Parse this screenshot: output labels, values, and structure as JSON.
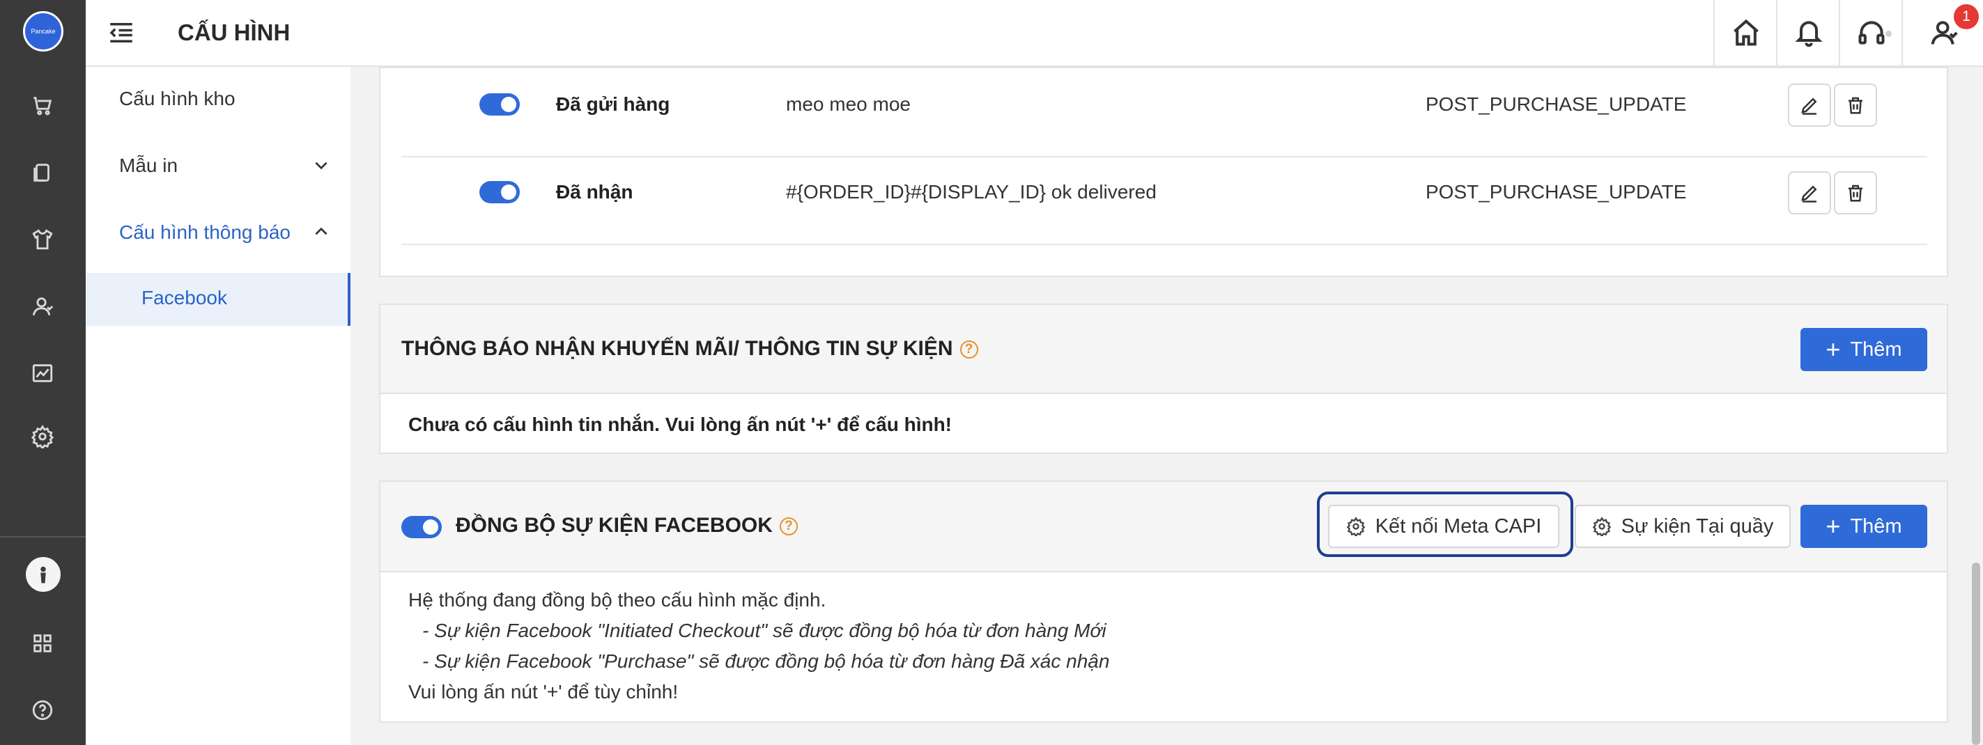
{
  "header": {
    "title": "CẤU HÌNH",
    "notification_badge": "1",
    "icons": [
      "home-icon",
      "bell-icon",
      "headset-icon",
      "user-icon"
    ]
  },
  "rail": {
    "logo_text": "Pancake",
    "icons": [
      "cart-icon",
      "orders-icon",
      "shirt-icon",
      "customers-icon",
      "chart-icon",
      "settings-icon",
      "apps-icon",
      "help-icon"
    ]
  },
  "sidebar": {
    "items": [
      {
        "label": "Cấu hình kho"
      },
      {
        "label": "Mẫu in"
      },
      {
        "label": "Cấu hình thông báo"
      }
    ],
    "sub_item": "Facebook"
  },
  "message_table": {
    "rows": [
      {
        "status": "Đã gửi hàng",
        "message": "meo meo moe",
        "tag": "POST_PURCHASE_UPDATE"
      },
      {
        "status": "Đã nhận",
        "message": "#{ORDER_ID}#{DISPLAY_ID} ok delivered",
        "tag": "POST_PURCHASE_UPDATE"
      }
    ]
  },
  "promo_panel": {
    "title": "THÔNG BÁO NHẬN KHUYẾN MÃI/ THÔNG TIN SỰ KIỆN",
    "add_label": "Thêm",
    "empty_text": "Chưa có cấu hình tin nhắn. Vui lòng ấn nút '+' để cấu hình!"
  },
  "sync_panel": {
    "title": "ĐỒNG BỘ SỰ KIỆN FACEBOOK",
    "connect_label": "Kết nối Meta CAPI",
    "pos_event_label": "Sự kiện Tại quầy",
    "add_label": "Thêm",
    "line1": "Hệ thống đang đồng bộ theo cấu hình mặc định.",
    "line2": "- Sự kiện Facebook \"Initiated Checkout\" sẽ được đồng bộ hóa từ đơn hàng Mới",
    "line3": "- Sự kiện Facebook \"Purchase\" sẽ được đồng bộ hóa từ đơn hàng Đã xác nhận",
    "line4": "Vui lòng ấn nút '+' để tùy chỉnh!"
  },
  "colors": {
    "primary": "#2f6bd8",
    "rail": "#3a3a3a",
    "help": "#e8912f",
    "badge": "#e53935"
  }
}
